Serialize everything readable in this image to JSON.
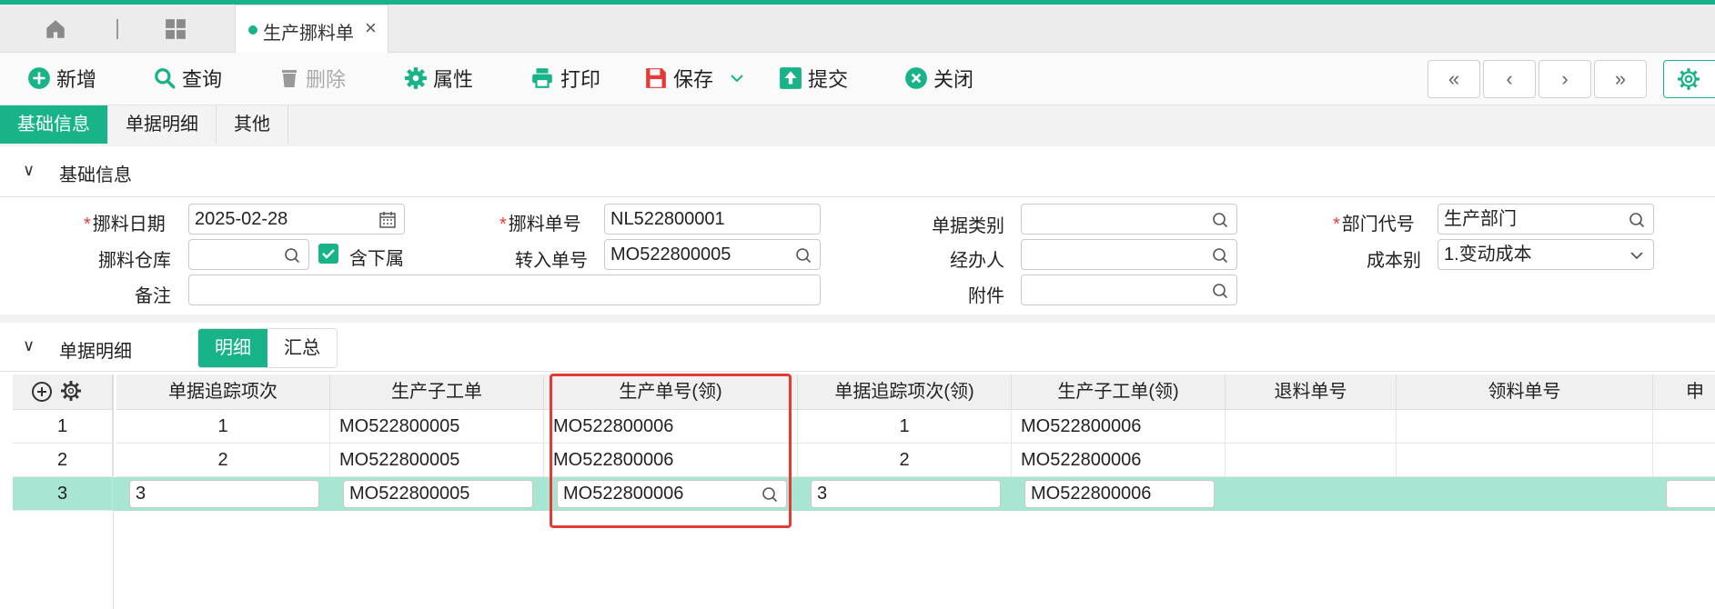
{
  "window": {
    "tab_title": "生产挪料单"
  },
  "toolbar": {
    "add": "新增",
    "query": "查询",
    "delete": "删除",
    "properties": "属性",
    "print": "打印",
    "save": "保存",
    "submit": "提交",
    "close": "关闭"
  },
  "subtabs": [
    "基础信息",
    "单据明细",
    "其他"
  ],
  "basic_section": {
    "title": "基础信息",
    "fields": {
      "date_label": "挪料日期",
      "date_value": "2025-02-28",
      "doc_no_label": "挪料单号",
      "doc_no_value": "NL522800001",
      "doc_type_label": "单据类别",
      "doc_type_value": "",
      "dept_label": "部门代号",
      "dept_value": "生产部门",
      "warehouse_label": "挪料仓库",
      "warehouse_value": "",
      "include_sub_label": "含下属",
      "include_sub_checked": true,
      "transfer_no_label": "转入单号",
      "transfer_no_value": "MO522800005",
      "handler_label": "经办人",
      "handler_value": "",
      "cost_label": "成本别",
      "cost_value": "1.变动成本",
      "remark_label": "备注",
      "remark_value": "",
      "attach_label": "附件",
      "attach_value": ""
    }
  },
  "detail_section": {
    "title": "单据明细",
    "toggle": [
      "明细",
      "汇总"
    ],
    "columns": [
      "单据追踪项次",
      "生产子工单",
      "生产单号(领)",
      "单据追踪项次(领)",
      "生产子工单(领)",
      "退料单号",
      "领料单号",
      "申"
    ],
    "rows": [
      {
        "no": "1",
        "trace": "1",
        "sub_order": "MO522800005",
        "mo_pick": "MO522800006",
        "trace_pick": "1",
        "sub_order_pick": "MO522800006",
        "return_no": "",
        "pick_no": ""
      },
      {
        "no": "2",
        "trace": "2",
        "sub_order": "MO522800005",
        "mo_pick": "MO522800006",
        "trace_pick": "2",
        "sub_order_pick": "MO522800006",
        "return_no": "",
        "pick_no": ""
      },
      {
        "no": "3",
        "trace": "3",
        "sub_order": "MO522800005",
        "mo_pick": "MO522800006",
        "trace_pick": "3",
        "sub_order_pick": "MO522800006",
        "return_no": "",
        "pick_no": ""
      }
    ]
  },
  "colors": {
    "accent": "#19b38a",
    "selected_row": "#a8e6d3",
    "highlight_box": "#e53935"
  }
}
